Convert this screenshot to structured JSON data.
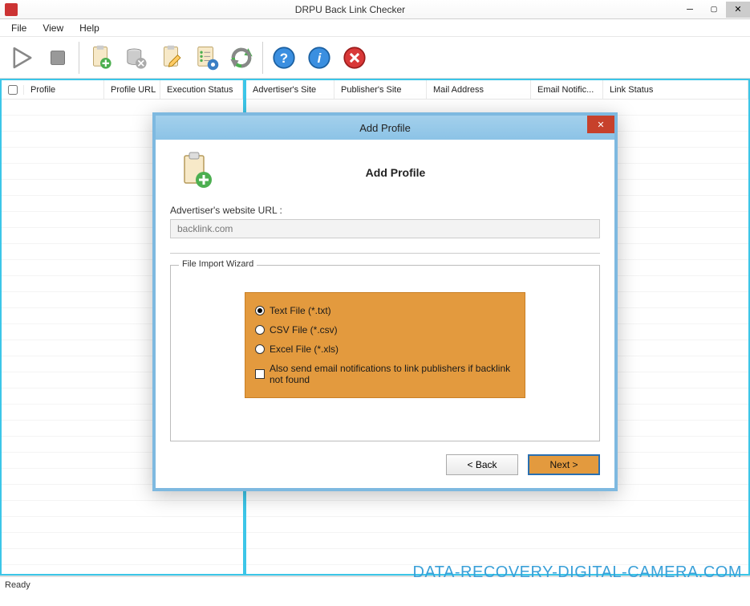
{
  "window": {
    "title": "DRPU Back Link Checker"
  },
  "menu": {
    "file": "File",
    "view": "View",
    "help": "Help"
  },
  "left_cols": {
    "profile": "Profile",
    "profile_url": "Profile URL",
    "exec_status": "Execution Status"
  },
  "right_cols": {
    "advertiser": "Advertiser's Site",
    "publisher": "Publisher's Site",
    "mail": "Mail Address",
    "email_notif": "Email Notific...",
    "link_status": "Link Status"
  },
  "status": {
    "text": "Ready"
  },
  "watermark": {
    "text": "DATA-RECOVERY-DIGITAL-CAMERA.COM"
  },
  "dialog": {
    "title": "Add Profile",
    "heading": "Add Profile",
    "url_label": "Advertiser's website URL :",
    "url_value": "backlink.com",
    "fieldset_label": "File Import Wizard",
    "opt_txt": "Text File (*.txt)",
    "opt_csv": "CSV File (*.csv)",
    "opt_xls": "Excel File (*.xls)",
    "opt_email": "Also send email notifications to link publishers if backlink not found",
    "back": "< Back",
    "next": "Next >"
  }
}
